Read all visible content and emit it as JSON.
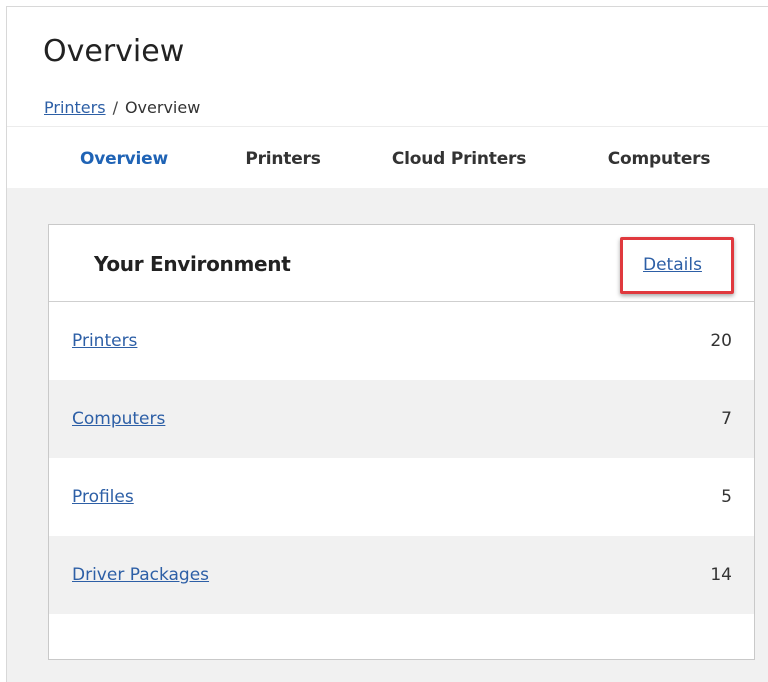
{
  "page": {
    "title": "Overview",
    "breadcrumb": {
      "parent": "Printers",
      "separator": "/",
      "current": "Overview"
    }
  },
  "tabs": [
    {
      "label": "Overview",
      "active": true
    },
    {
      "label": "Printers",
      "active": false
    },
    {
      "label": "Cloud Printers",
      "active": false
    },
    {
      "label": "Computers",
      "active": false
    }
  ],
  "environment": {
    "title": "Your Environment",
    "details_label": "Details",
    "rows": [
      {
        "label": "Printers",
        "count": "20"
      },
      {
        "label": "Computers",
        "count": "7"
      },
      {
        "label": "Profiles",
        "count": "5"
      },
      {
        "label": "Driver Packages",
        "count": "14"
      }
    ]
  },
  "colors": {
    "accent": "#1f63b5",
    "link": "#2d5fa6",
    "highlight": "#e0393e"
  }
}
